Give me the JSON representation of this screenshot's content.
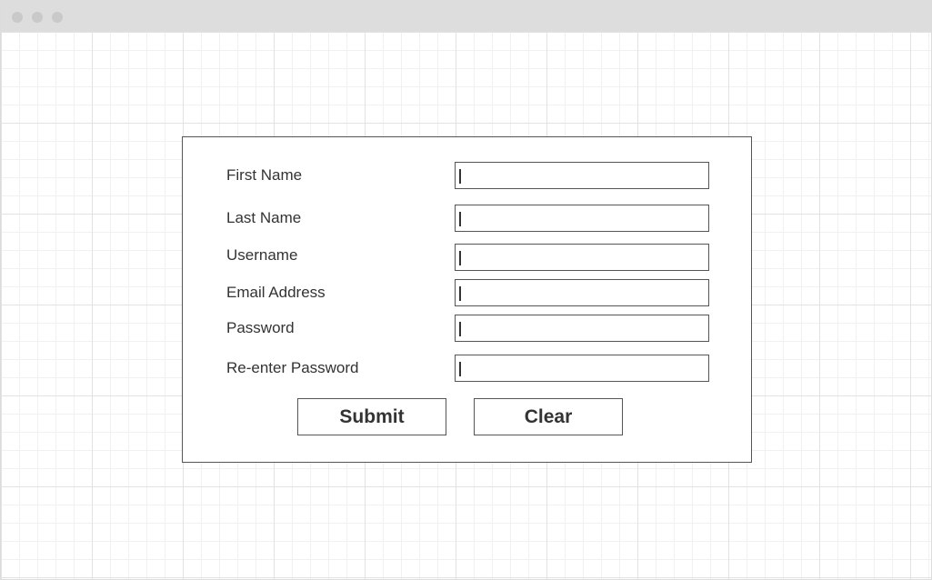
{
  "window": {
    "controls": [
      "window-dot",
      "window-dot",
      "window-dot"
    ]
  },
  "form": {
    "fields": [
      {
        "label": "First Name",
        "value": ""
      },
      {
        "label": "Last Name",
        "value": ""
      },
      {
        "label": "Username",
        "value": ""
      },
      {
        "label": "Email Address",
        "value": ""
      },
      {
        "label": "Password",
        "value": ""
      },
      {
        "label": "Re-enter Password",
        "value": ""
      }
    ],
    "submit_label": "Submit",
    "clear_label": "Clear"
  },
  "colors": {
    "titlebar": "#dddddd",
    "border": "#555555",
    "text": "#333333",
    "grid": "#e2e2e2"
  }
}
